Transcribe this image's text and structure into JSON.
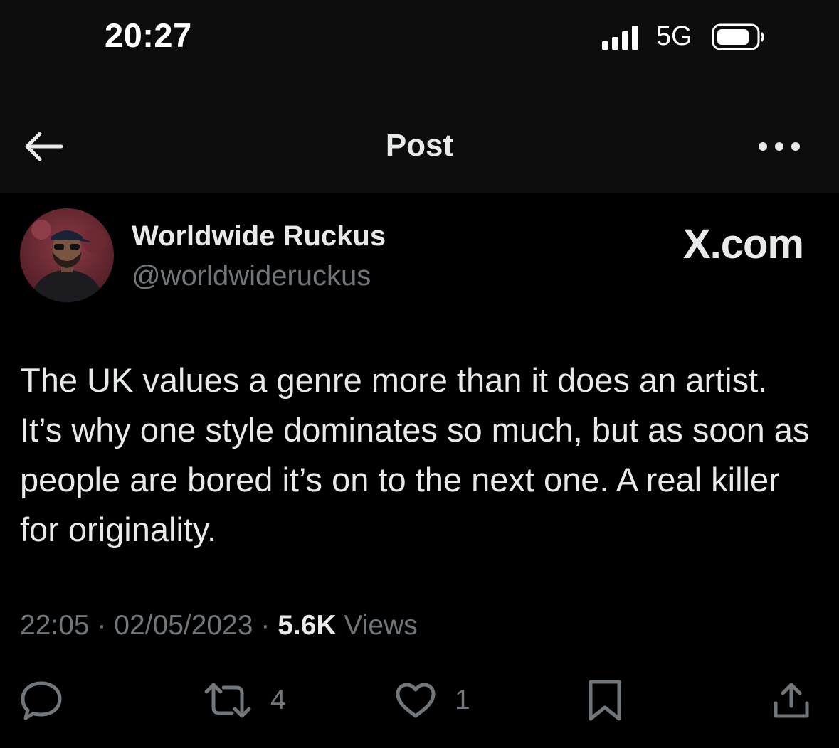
{
  "status_bar": {
    "time": "20:27",
    "network": "5G",
    "icons": [
      "signal-icon",
      "battery-icon"
    ]
  },
  "nav": {
    "title": "Post",
    "icons": [
      "back-arrow-icon",
      "more-icon"
    ]
  },
  "post": {
    "author_name": "Worldwide Ruckus",
    "author_handle": "@worldwideruckus",
    "watermark": "X.com",
    "text": "The UK values a genre more than it does an artist. It’s why one style dominates so much, but as soon as people are bored it’s on to the next one. A real killer for originality.",
    "time": "22:05",
    "separator": "·",
    "date": "02/05/2023",
    "views_count": "5.6K",
    "views_label": "Views"
  },
  "actions": {
    "reply_icon": "reply-icon",
    "retweet_icon": "retweet-icon",
    "retweet_count": "4",
    "like_icon": "heart-icon",
    "like_count": "1",
    "bookmark_icon": "bookmark-icon",
    "share_icon": "share-icon"
  },
  "colors": {
    "background": "#000000",
    "header_background": "#0d0d0d",
    "primary_text": "#e7e9ea",
    "secondary_text": "#71767b"
  }
}
